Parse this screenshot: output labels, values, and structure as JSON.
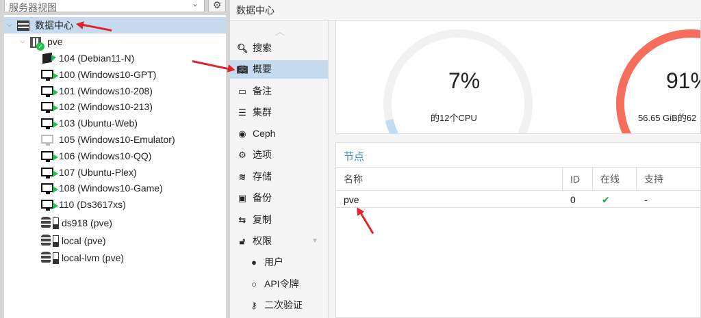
{
  "left_panel": {
    "view_select": "服务器视图",
    "tree": {
      "datacenter": "数据中心",
      "node": "pve",
      "guests": [
        {
          "label": "104 (Debian11-N)",
          "icon": "container-running-icon"
        },
        {
          "label": "100 (Windows10-GPT)",
          "icon": "vm-running-icon"
        },
        {
          "label": "101 (Windows10-208)",
          "icon": "vm-running-icon"
        },
        {
          "label": "102 (Windows10-213)",
          "icon": "vm-running-icon"
        },
        {
          "label": "103 (Ubuntu-Web)",
          "icon": "vm-running-icon"
        },
        {
          "label": "105 (Windows10-Emulator)",
          "icon": "vm-stopped-icon"
        },
        {
          "label": "106 (Windows10-QQ)",
          "icon": "vm-running-icon"
        },
        {
          "label": "107 (Ubuntu-Plex)",
          "icon": "vm-running-icon"
        },
        {
          "label": "108 (Windows10-Game)",
          "icon": "vm-running-icon"
        },
        {
          "label": "110 (Ds3617xs)",
          "icon": "vm-running-icon"
        }
      ],
      "storages": [
        {
          "label": "ds918 (pve)"
        },
        {
          "label": "local (pve)"
        },
        {
          "label": "local-lvm (pve)"
        }
      ]
    }
  },
  "topbar": {
    "title": "数据中心"
  },
  "nav": {
    "items": [
      {
        "label": "搜索",
        "icon": "search-icon"
      },
      {
        "label": "概要",
        "icon": "book-icon"
      },
      {
        "label": "备注",
        "icon": "note-icon"
      },
      {
        "label": "集群",
        "icon": "server-icon"
      },
      {
        "label": "Ceph",
        "icon": "ceph-icon"
      },
      {
        "label": "选项",
        "icon": "gear-icon"
      },
      {
        "label": "存储",
        "icon": "database-icon"
      },
      {
        "label": "备份",
        "icon": "floppy-icon"
      },
      {
        "label": "复制",
        "icon": "retweet-icon"
      },
      {
        "label": "权限",
        "icon": "unlock-icon"
      },
      {
        "label": "用户",
        "icon": "user-icon"
      },
      {
        "label": "API令牌",
        "icon": "user-outline-icon"
      },
      {
        "label": "二次验证",
        "icon": "key-icon"
      }
    ]
  },
  "summary": {
    "cpu": {
      "value": "7%",
      "sub": "的12个CPU",
      "fraction": 0.07
    },
    "memory": {
      "value": "91%",
      "sub": "56.65 GiB的62",
      "fraction": 0.91
    }
  },
  "nodes": {
    "title": "节点",
    "columns": [
      "名称",
      "ID",
      "在线",
      "支持"
    ],
    "rows": [
      {
        "name": "pve",
        "id": "0",
        "online": "✔",
        "support": "-"
      }
    ]
  },
  "colors": {
    "selection": "#c6dbef",
    "accent": "#3f8ec8",
    "online": "#21a845",
    "cpu_gauge": "#c2dcf2",
    "mem_gauge": "#f66d5c",
    "annotation_arrow": "#e0242b"
  }
}
